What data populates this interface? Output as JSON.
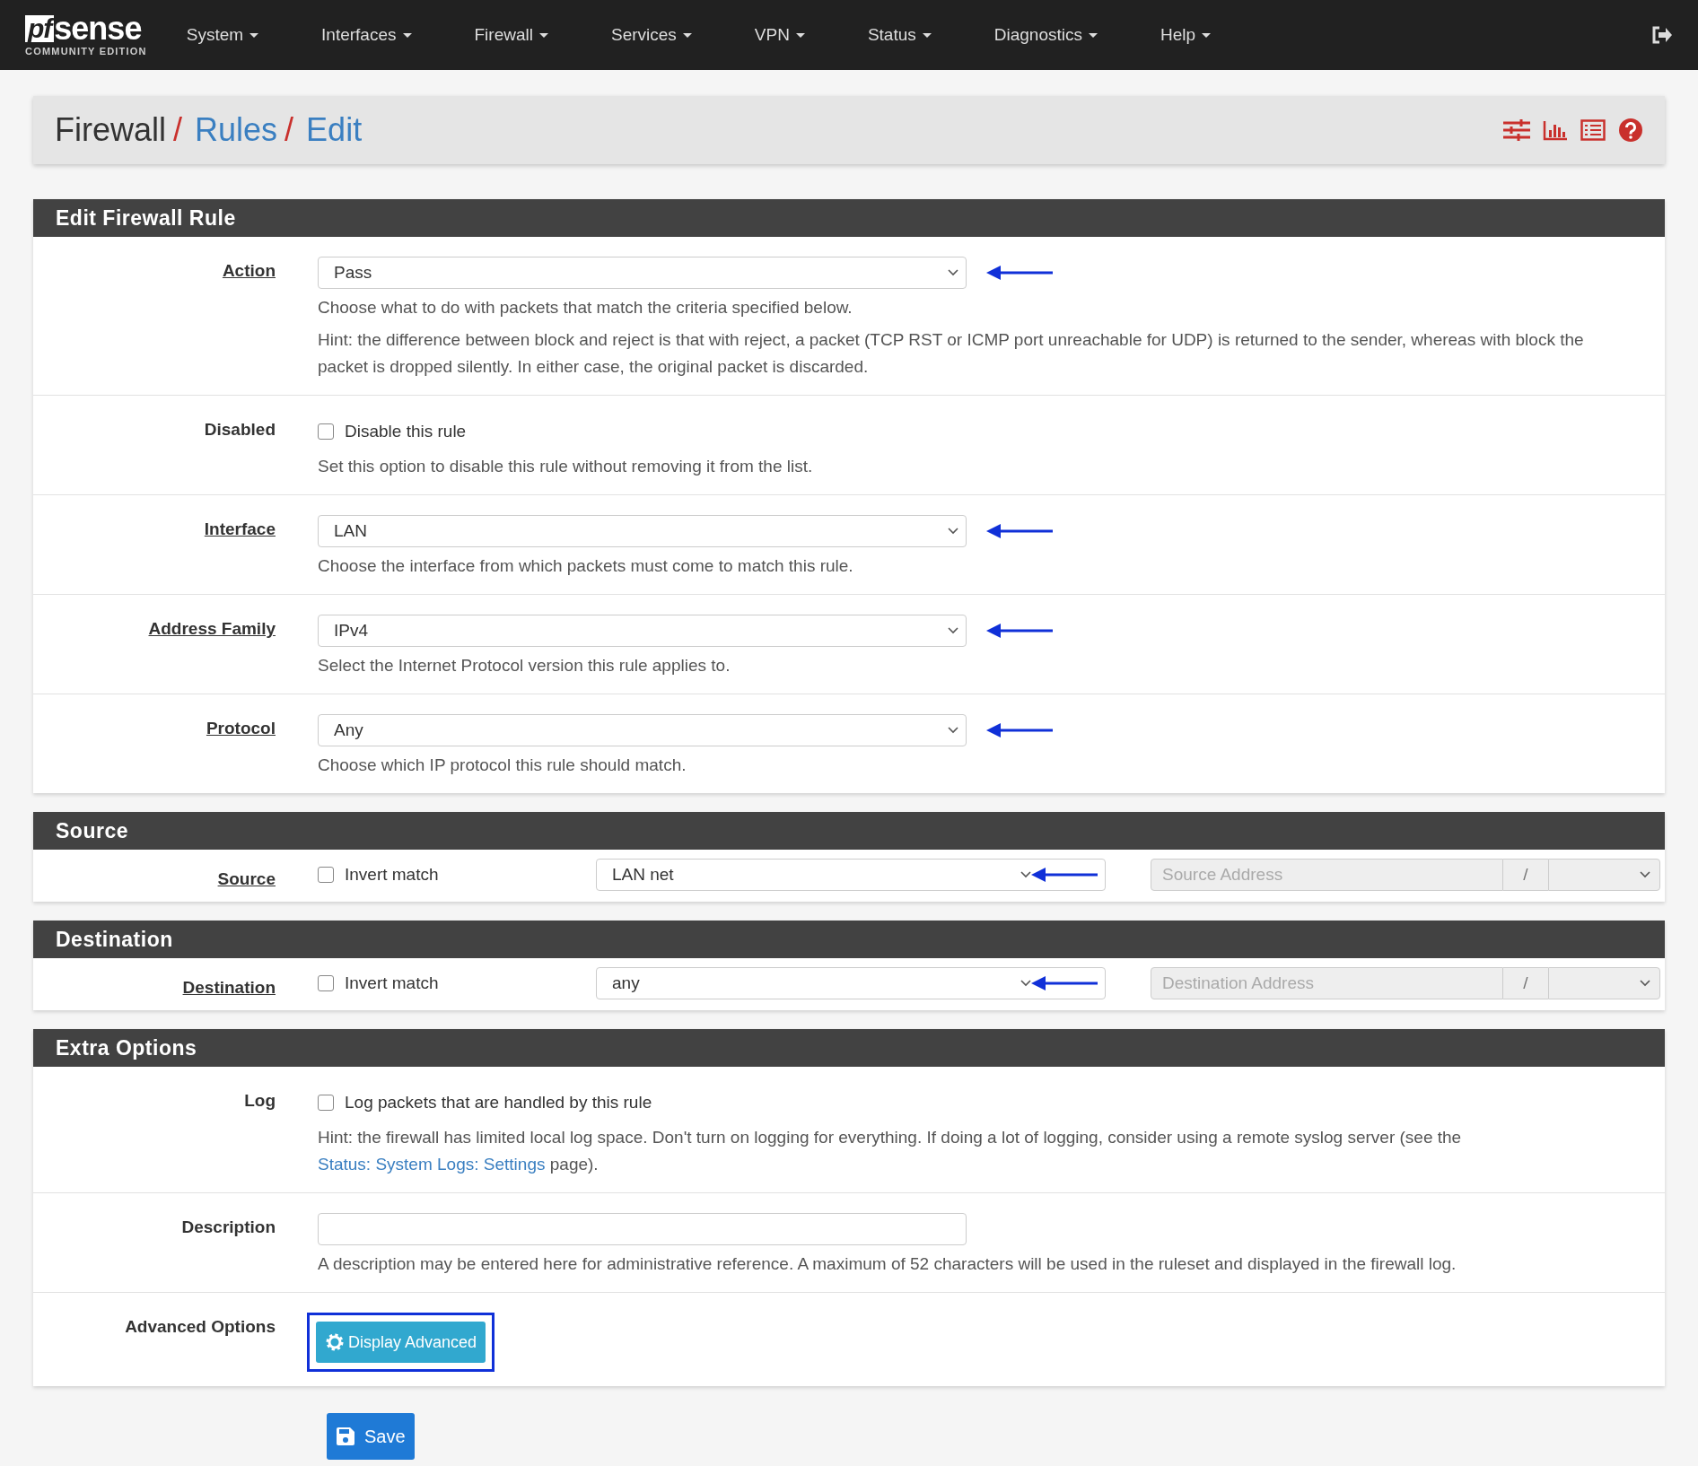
{
  "nav": {
    "logo": {
      "mark": "pf",
      "word": "sense",
      "edition": "COMMUNITY EDITION"
    },
    "menus": [
      "System",
      "Interfaces",
      "Firewall",
      "Services",
      "VPN",
      "Status",
      "Diagnostics",
      "Help"
    ]
  },
  "breadcrumb": [
    {
      "label": "Firewall",
      "link": false,
      "separator": "/"
    },
    {
      "label": "Rules",
      "link": true,
      "separator": "/"
    },
    {
      "label": "Edit",
      "link": true
    }
  ],
  "sections": [
    {
      "title": "Edit Firewall Rule",
      "rows": [
        {
          "kind": "select",
          "label": "Action",
          "label_link": true,
          "value": "Pass",
          "arrow": true,
          "help": [
            [
              {
                "text": "Choose what to do with packets that match the criteria specified below."
              }
            ],
            [
              {
                "text": "Hint: the difference between block and reject is that with reject, a packet (TCP RST or ICMP port unreachable for UDP) is returned to the sender, whereas with block the packet is dropped silently. In either case, the original packet is discarded."
              }
            ]
          ]
        },
        {
          "kind": "checkbox",
          "label": "Disabled",
          "label_link": false,
          "checked": false,
          "check_label": "Disable this rule",
          "help": [
            [
              {
                "text": "Set this option to disable this rule without removing it from the list."
              }
            ]
          ]
        },
        {
          "kind": "select",
          "label": "Interface",
          "label_link": true,
          "value": "LAN",
          "arrow": true,
          "help": [
            [
              {
                "text": "Choose the interface from which packets must come to match this rule."
              }
            ]
          ]
        },
        {
          "kind": "select",
          "label": "Address Family",
          "label_link": true,
          "value": "IPv4",
          "arrow": true,
          "help": [
            [
              {
                "text": "Select the Internet Protocol version this rule applies to."
              }
            ]
          ]
        },
        {
          "kind": "select",
          "label": "Protocol",
          "label_link": true,
          "value": "Any",
          "arrow": true,
          "help": [
            [
              {
                "text": "Choose which IP protocol this rule should match."
              }
            ]
          ]
        }
      ]
    },
    {
      "title": "Source",
      "rows": [
        {
          "kind": "address",
          "label": "Source",
          "label_link": true,
          "checked": false,
          "check_label": "Invert match",
          "value": "LAN net",
          "arrow": true,
          "placeholder": "Source Address",
          "slash": "/"
        }
      ]
    },
    {
      "title": "Destination",
      "rows": [
        {
          "kind": "address",
          "label": "Destination",
          "label_link": true,
          "checked": false,
          "check_label": "Invert match",
          "value": "any",
          "arrow": true,
          "placeholder": "Destination Address",
          "slash": "/"
        }
      ]
    },
    {
      "title": "Extra Options",
      "rows": [
        {
          "kind": "checkbox",
          "label": "Log",
          "label_link": false,
          "checked": false,
          "check_label": "Log packets that are handled by this rule",
          "help": [
            [
              {
                "text": "Hint: the firewall has limited local log space. Don't turn on logging for everything. If doing a lot of logging, consider using a remote syslog server (see the "
              },
              {
                "text": "Status: System Logs: Settings",
                "link": true
              },
              {
                "text": " page)."
              }
            ]
          ]
        },
        {
          "kind": "text",
          "label": "Description",
          "label_link": false,
          "help": [
            [
              {
                "text": "A description may be entered here for administrative reference. A maximum of 52 characters will be used in the ruleset and displayed in the firewall log."
              }
            ]
          ]
        },
        {
          "kind": "button",
          "label": "Advanced Options",
          "label_link": false,
          "button": "Display Advanced",
          "highlighted": true
        }
      ]
    }
  ],
  "save": "Save"
}
